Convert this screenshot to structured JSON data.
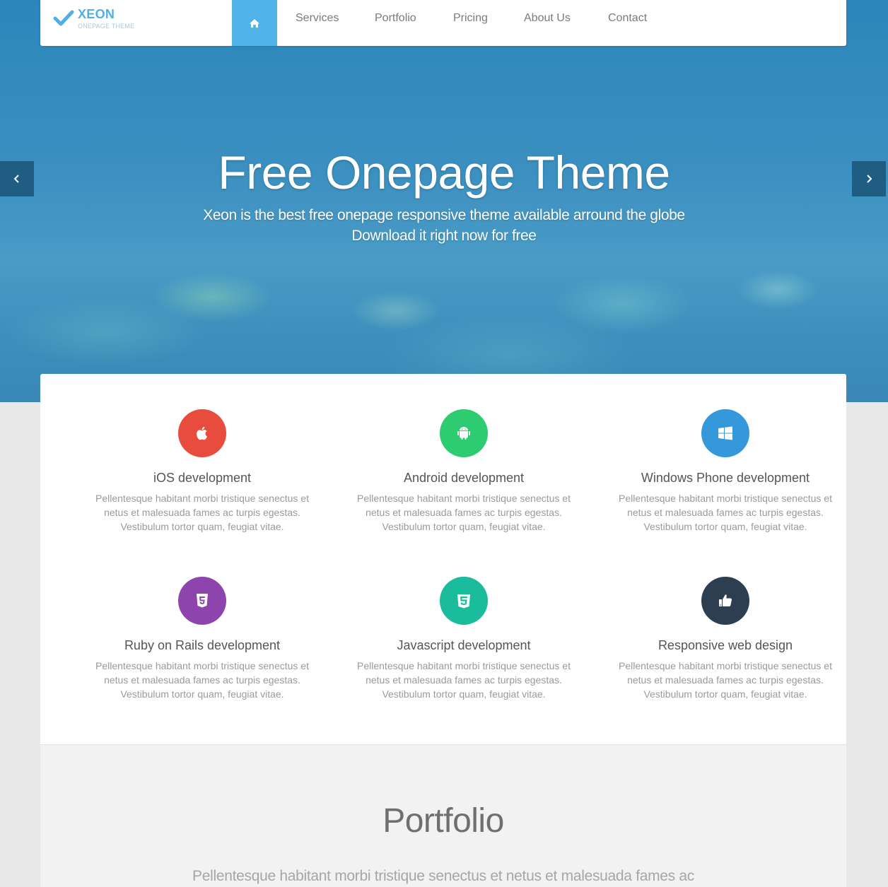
{
  "brand": {
    "name": "XEON",
    "tagline": "ONEPAGE THEME",
    "accent": "#4fb0e8"
  },
  "nav": {
    "home_icon": "home-icon",
    "items": [
      "Services",
      "Portfolio",
      "Pricing",
      "About Us",
      "Contact"
    ]
  },
  "hero": {
    "title": "Free Onepage Theme",
    "line1": "Xeon is the best free onepage responsive theme available arround the globe",
    "line2": "Download it right now for free",
    "prev_icon": "chevron-left-icon",
    "next_icon": "chevron-right-icon"
  },
  "services": [
    {
      "title": "iOS development",
      "icon": "apple-icon",
      "color": "#e74c3c",
      "line1": "Pellentesque habitant morbi tristique senectus et",
      "line2": "netus et malesuada fames ac turpis egestas.",
      "line3": "Vestibulum tortor quam, feugiat vitae."
    },
    {
      "title": "Android development",
      "icon": "android-icon",
      "color": "#2ecc71",
      "line1": "Pellentesque habitant morbi tristique senectus et",
      "line2": "netus et malesuada fames ac turpis egestas.",
      "line3": "Vestibulum tortor quam, feugiat vitae."
    },
    {
      "title": "Windows Phone development",
      "icon": "windows-icon",
      "color": "#3498db",
      "line1": "Pellentesque habitant morbi tristique senectus et",
      "line2": "netus et malesuada fames ac turpis egestas.",
      "line3": "Vestibulum tortor quam, feugiat vitae."
    },
    {
      "title": "Ruby on Rails development",
      "icon": "html5-icon",
      "color": "#8e44ad",
      "line1": "Pellentesque habitant morbi tristique senectus et",
      "line2": "netus et malesuada fames ac turpis egestas.",
      "line3": "Vestibulum tortor quam, feugiat vitae."
    },
    {
      "title": "Javascript development",
      "icon": "css3-icon",
      "color": "#1abc9c",
      "line1": "Pellentesque habitant morbi tristique senectus et",
      "line2": "netus et malesuada fames ac turpis egestas.",
      "line3": "Vestibulum tortor quam, feugiat vitae."
    },
    {
      "title": "Responsive web design",
      "icon": "thumbs-up-icon",
      "color": "#2c3e50",
      "line1": "Pellentesque habitant morbi tristique senectus et",
      "line2": "netus et malesuada fames ac turpis egestas.",
      "line3": "Vestibulum tortor quam, feugiat vitae."
    }
  ],
  "portfolio": {
    "title": "Portfolio",
    "intro": "Pellentesque habitant morbi tristique senectus et netus et malesuada fames ac"
  }
}
